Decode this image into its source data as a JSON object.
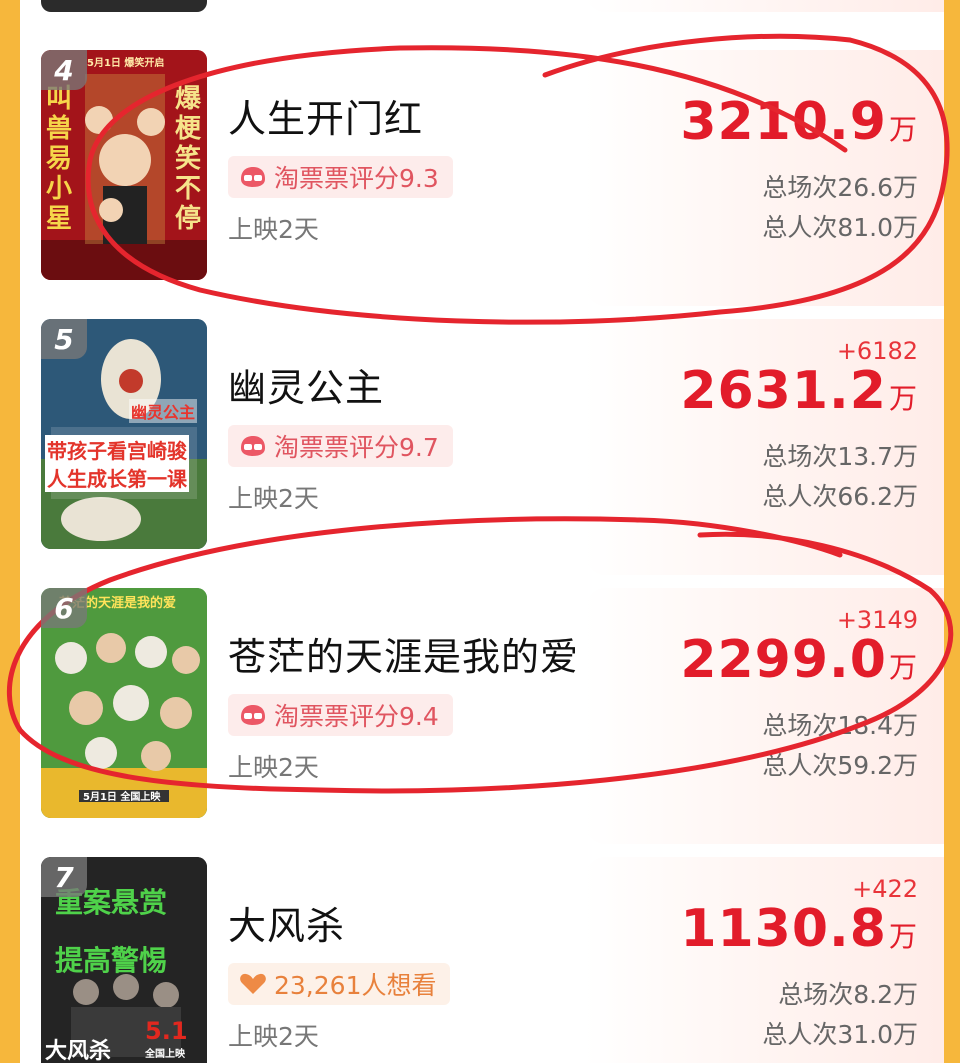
{
  "accent_color": "#e21c2a",
  "background_color": "#f6b73c",
  "movies": [
    {
      "rank": "4",
      "title": "人生开门红",
      "delta": "",
      "box_value": "3210.9",
      "unit": "万",
      "badge_icon": "taopiaopiao-rating-icon",
      "badge_text": "淘票票评分9.3",
      "sessions": "总场次26.6万",
      "viewers": "总人次81.0万",
      "days": "上映2天",
      "poster_text": [
        "爆梗笑不停",
        "叫兽易小星",
        "5月1日 爆笑开启"
      ]
    },
    {
      "rank": "5",
      "title": "幽灵公主",
      "delta": "+6182",
      "box_value": "2631.2",
      "unit": "万",
      "badge_icon": "taopiaopiao-rating-icon",
      "badge_text": "淘票票评分9.7",
      "sessions": "总场次13.7万",
      "viewers": "总人次66.2万",
      "days": "上映2天",
      "poster_text": [
        "幽灵公主",
        "带孩子看宫崎骏",
        "人生成长第一课"
      ]
    },
    {
      "rank": "6",
      "title": "苍茫的天涯是我的爱",
      "delta": "+3149",
      "box_value": "2299.0",
      "unit": "万",
      "badge_icon": "taopiaopiao-rating-icon",
      "badge_text": "淘票票评分9.4",
      "sessions": "总场次18.4万",
      "viewers": "总人次59.2万",
      "days": "上映2天",
      "poster_text": [
        "苍茫的天涯是我的爱",
        "5月1日 全国上映"
      ]
    },
    {
      "rank": "7",
      "title": "大风杀",
      "delta": "+422",
      "box_value": "1130.8",
      "unit": "万",
      "badge_icon": "heart-icon",
      "badge_text": "23,261人想看",
      "sessions": "总场次8.2万",
      "viewers": "总人次31.0万",
      "days": "上映2天",
      "poster_text": [
        "重案悬赏",
        "提高警惕",
        "大风杀",
        "5.1",
        "全国上映"
      ]
    }
  ]
}
